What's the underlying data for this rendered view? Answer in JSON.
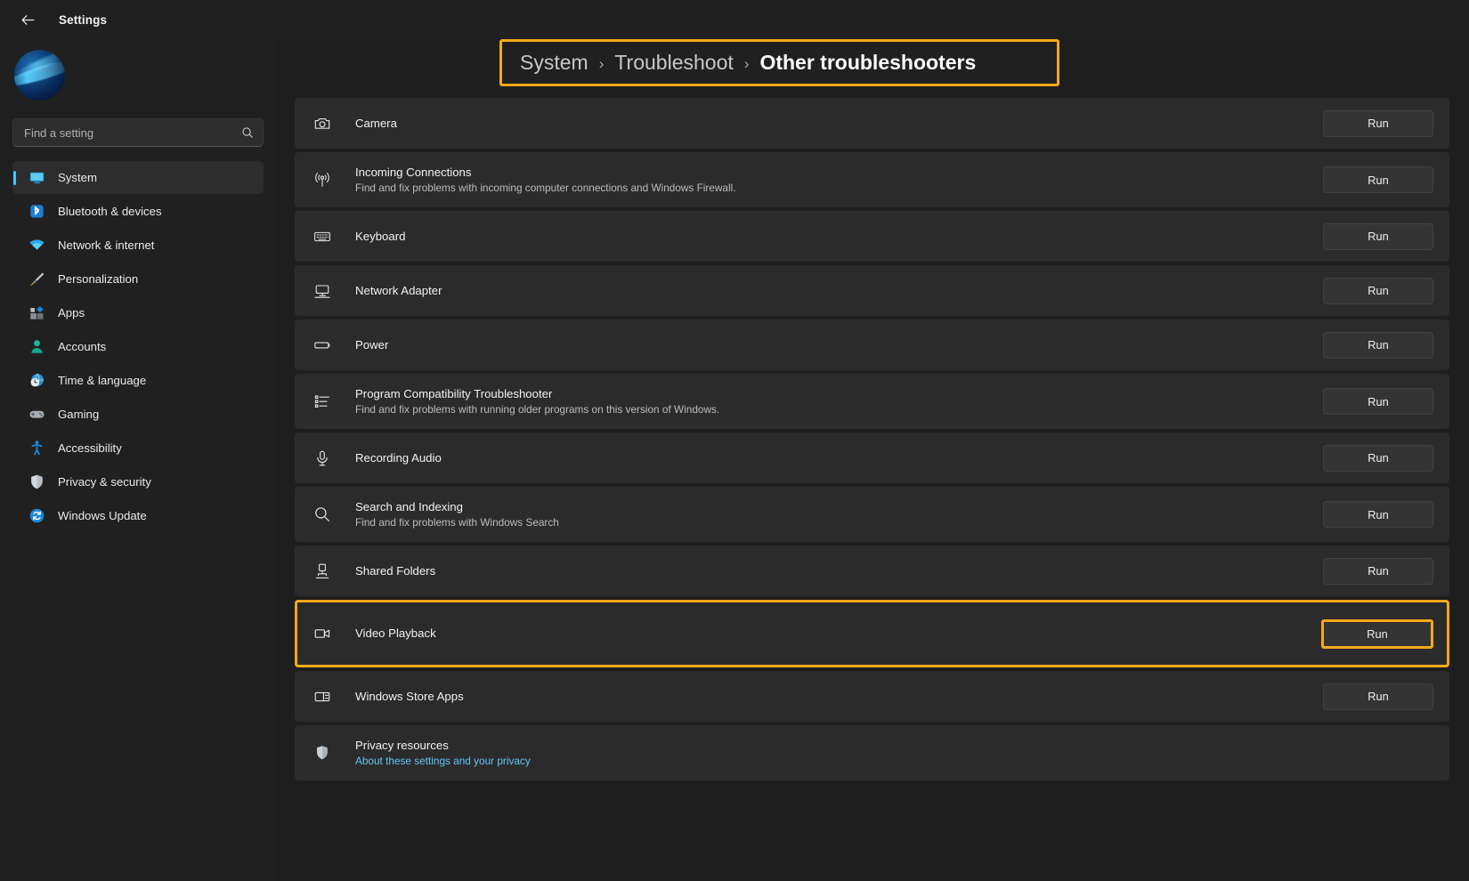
{
  "window": {
    "title": "Settings",
    "back_icon": "back-arrow-icon"
  },
  "sidebar": {
    "avatar": "user-avatar",
    "search": {
      "placeholder": "Find a setting",
      "value": "",
      "icon": "search-icon"
    },
    "items": [
      {
        "label": "System",
        "icon": "display-icon",
        "active": true
      },
      {
        "label": "Bluetooth & devices",
        "icon": "bluetooth-icon",
        "active": false
      },
      {
        "label": "Network & internet",
        "icon": "wifi-icon",
        "active": false
      },
      {
        "label": "Personalization",
        "icon": "paintbrush-icon",
        "active": false
      },
      {
        "label": "Apps",
        "icon": "apps-icon",
        "active": false
      },
      {
        "label": "Accounts",
        "icon": "person-icon",
        "active": false
      },
      {
        "label": "Time & language",
        "icon": "clock-globe-icon",
        "active": false
      },
      {
        "label": "Gaming",
        "icon": "gamepad-icon",
        "active": false
      },
      {
        "label": "Accessibility",
        "icon": "accessibility-icon",
        "active": false
      },
      {
        "label": "Privacy & security",
        "icon": "shield-icon",
        "active": false
      },
      {
        "label": "Windows Update",
        "icon": "refresh-icon",
        "active": false
      }
    ]
  },
  "breadcrumb": {
    "root": "System",
    "separator": "›",
    "middle": "Troubleshoot",
    "current": "Other troubleshooters",
    "highlight_color": "#f7a81b"
  },
  "troubleshooters": {
    "run_label": "Run",
    "items": [
      {
        "title": "Camera",
        "subtitle": "",
        "icon": "camera-icon",
        "action": "Run",
        "highlighted": false
      },
      {
        "title": "Incoming Connections",
        "subtitle": "Find and fix problems with incoming computer connections and Windows Firewall.",
        "icon": "broadcast-icon",
        "action": "Run",
        "highlighted": false
      },
      {
        "title": "Keyboard",
        "subtitle": "",
        "icon": "keyboard-icon",
        "action": "Run",
        "highlighted": false
      },
      {
        "title": "Network Adapter",
        "subtitle": "",
        "icon": "network-adapter-icon",
        "action": "Run",
        "highlighted": false
      },
      {
        "title": "Power",
        "subtitle": "",
        "icon": "battery-icon",
        "action": "Run",
        "highlighted": false
      },
      {
        "title": "Program Compatibility Troubleshooter",
        "subtitle": "Find and fix problems with running older programs on this version of Windows.",
        "icon": "list-icon",
        "action": "Run",
        "highlighted": false
      },
      {
        "title": "Recording Audio",
        "subtitle": "",
        "icon": "microphone-icon",
        "action": "Run",
        "highlighted": false
      },
      {
        "title": "Search and Indexing",
        "subtitle": "Find and fix problems with Windows Search",
        "icon": "search-icon",
        "action": "Run",
        "highlighted": false
      },
      {
        "title": "Shared Folders",
        "subtitle": "",
        "icon": "shared-folder-icon",
        "action": "Run",
        "highlighted": false
      },
      {
        "title": "Video Playback",
        "subtitle": "",
        "icon": "video-camera-icon",
        "action": "Run",
        "highlighted": true
      },
      {
        "title": "Windows Store Apps",
        "subtitle": "",
        "icon": "store-app-icon",
        "action": "Run",
        "highlighted": false
      }
    ],
    "privacy": {
      "title": "Privacy resources",
      "link": "About these settings and your privacy",
      "icon": "shield-icon",
      "link_color": "#62c7f5"
    }
  }
}
